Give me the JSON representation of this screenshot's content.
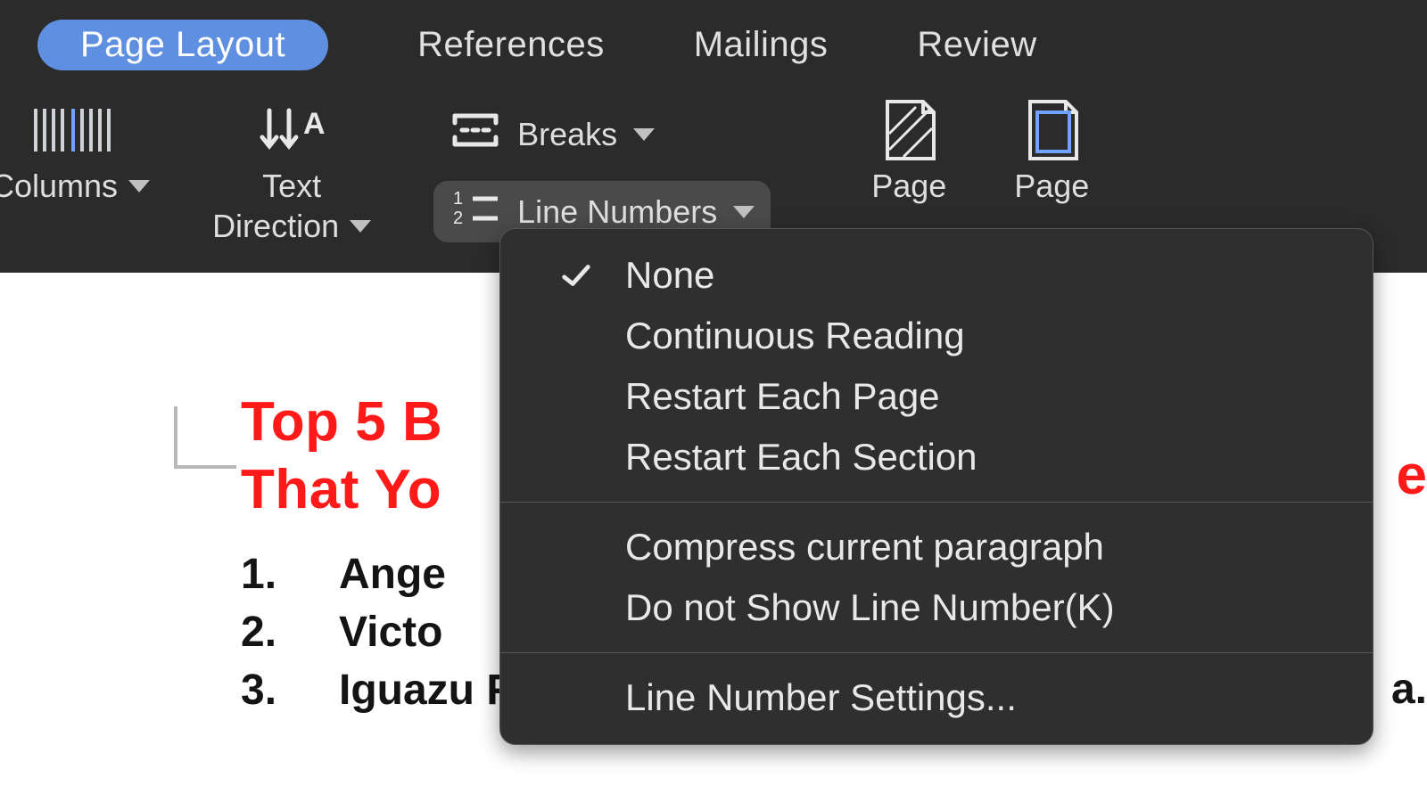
{
  "tabs": {
    "page_layout": "Page Layout",
    "references": "References",
    "mailings": "Mailings",
    "review": "Review"
  },
  "ribbon": {
    "columns": "Columns",
    "text_direction_line1": "Text",
    "text_direction_line2": "Direction",
    "breaks": "Breaks",
    "line_numbers": "Line Numbers",
    "page1": "Page",
    "page2": "Page"
  },
  "line_numbers_menu": {
    "none": "None",
    "continuous": "Continuous Reading",
    "restart_page": "Restart Each Page",
    "restart_section": "Restart Each Section",
    "compress": "Compress current paragraph",
    "do_not_show": "Do not Show Line Number(K)",
    "settings": "Line Number Settings..."
  },
  "document": {
    "title_line1": "Top 5 B",
    "title_line2": "That Yo",
    "trail_red": "e",
    "list": [
      {
        "n": "1.",
        "text": "Ange"
      },
      {
        "n": "2.",
        "text": "Victo"
      },
      {
        "n": "3.",
        "text": "Iguazu Falls, Brazil, and Argentina"
      }
    ],
    "trail_black": "a."
  }
}
